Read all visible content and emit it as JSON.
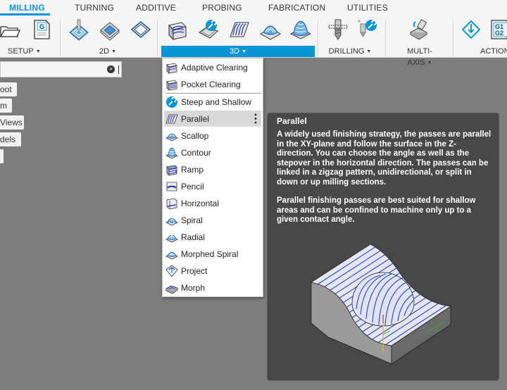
{
  "tabs": [
    {
      "label": "MILLING",
      "active": true
    },
    {
      "label": "TURNING"
    },
    {
      "label": "ADDITIVE"
    },
    {
      "label": "PROBING"
    },
    {
      "label": "FABRICATION"
    },
    {
      "label": "UTILITIES"
    }
  ],
  "ribbon": {
    "groups": [
      {
        "label": "SETUP"
      },
      {
        "label": "2D"
      },
      {
        "label": "3D",
        "active": true
      },
      {
        "label": "DRILLING"
      },
      {
        "label": "MULTI-AXIS"
      },
      {
        "label": "ACTION"
      }
    ],
    "gcode_icon_text": "G",
    "gcode_icon_text2": "G1",
    "gcode_icon_text3": "G2"
  },
  "browser": {
    "clear_icon": "close-icon",
    "items": [
      {
        "label": "oot"
      },
      {
        "label": "m"
      },
      {
        "label": "Views"
      },
      {
        "label": "dels"
      },
      {
        "label": ""
      }
    ]
  },
  "menu": {
    "items": [
      {
        "label": "Adaptive Clearing",
        "icon": "adaptive-clearing-icon"
      },
      {
        "label": "Pocket Clearing",
        "icon": "pocket-clearing-icon"
      },
      {
        "label": "Steep and Shallow",
        "icon": "steep-and-shallow-icon"
      },
      {
        "label": "Parallel",
        "icon": "parallel-icon",
        "highlighted": true
      },
      {
        "label": "Scallop",
        "icon": "scallop-icon"
      },
      {
        "label": "Contour",
        "icon": "contour-icon"
      },
      {
        "label": "Ramp",
        "icon": "ramp-icon"
      },
      {
        "label": "Pencil",
        "icon": "pencil-icon"
      },
      {
        "label": "Horizontal",
        "icon": "horizontal-icon"
      },
      {
        "label": "Spiral",
        "icon": "spiral-icon"
      },
      {
        "label": "Radial",
        "icon": "radial-icon"
      },
      {
        "label": "Morphed Spiral",
        "icon": "morphed-spiral-icon"
      },
      {
        "label": "Project",
        "icon": "project-icon"
      },
      {
        "label": "Morph",
        "icon": "morph-icon"
      }
    ]
  },
  "tooltip": {
    "title": "Parallel",
    "paragraph1": "A widely used finishing strategy, the passes are parallel in the XY-plane and follow the surface in the Z-direction. You can choose the angle as well as the stepover in the horizontal direction. The passes can be linked in a zigzag pattern, unidirectional, or split in down or up milling sections.",
    "paragraph2": "Parallel finishing passes are best suited for shallow areas and can be confined to machine only up to a given contact angle."
  },
  "colors": {
    "accent": "#0696d7",
    "toolpath": "#2a3fd0"
  }
}
